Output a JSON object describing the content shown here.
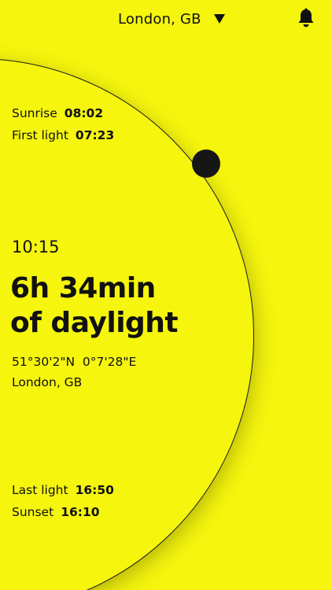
{
  "header": {
    "location": "London, GB",
    "icons": {
      "dropdown": "caret-down-icon",
      "notifications": "bell-icon"
    }
  },
  "sun": {
    "sunrise_label": "Sunrise",
    "sunrise_time": "08:02",
    "first_light_label": "First light",
    "first_light_time": "07:23",
    "current_time": "10:15",
    "daylight_line1": "6h 34min",
    "daylight_line2": "of daylight",
    "coordinates": "51°30'2\"N  0°7'28\"E",
    "place": "London, GB",
    "last_light_label": "Last light",
    "last_light_time": "16:50",
    "sunset_label": "Sunset",
    "sunset_time": "16:10"
  },
  "colors": {
    "background": "#f5f50e",
    "ink": "#111111"
  }
}
